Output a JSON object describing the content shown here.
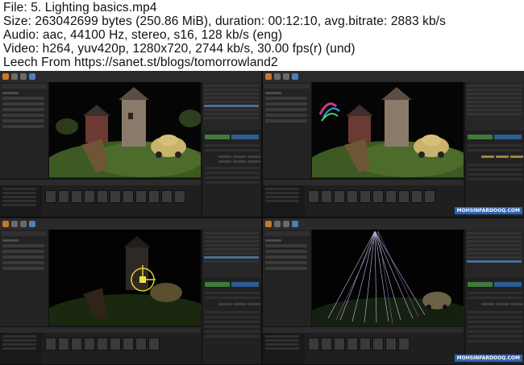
{
  "header": {
    "file_line": "File: 5. Lighting basics.mp4",
    "size_line": "Size: 263042699 bytes (250.86 MiB), duration: 00:12:10, avg.bitrate: 2883 kb/s",
    "audio_line": "Audio: aac, 44100 Hz, stereo, s16, 128 kb/s (eng)",
    "video_line": "Video: h264, yuv420p, 1280x720, 2744 kb/s, 30.00 fps(r) (und)",
    "leech_line": "Leech From https://sanet.st/blogs/tomorrowland2"
  },
  "thumbnails": {
    "watermark": "MOHSINFARDOOQ.COM"
  },
  "colors": {
    "accent_green": "#3f7a3a",
    "accent_blue": "#2d5d93",
    "watermark_blue": "#2b63b5"
  }
}
